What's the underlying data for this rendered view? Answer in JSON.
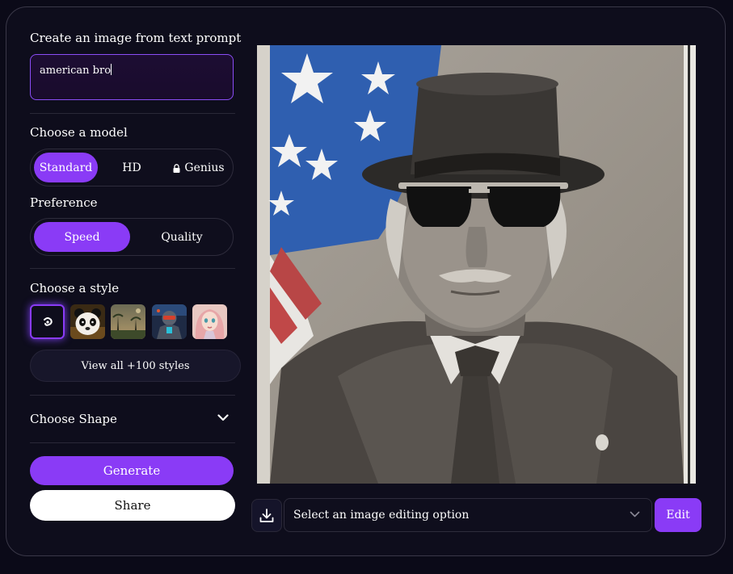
{
  "prompt": {
    "label": "Create an image from text prompt",
    "value": "american bro"
  },
  "model": {
    "label": "Choose a model",
    "options": [
      "Standard",
      "HD",
      "Genius"
    ],
    "selected": "Standard"
  },
  "preference": {
    "label": "Preference",
    "options": [
      "Speed",
      "Quality"
    ],
    "selected": "Speed"
  },
  "style": {
    "label": "Choose a style",
    "view_all_label": "View all +100 styles",
    "thumb_icons": [
      "swirl-icon",
      "panda-thumbnail",
      "landscape-thumbnail",
      "robot-thumbnail",
      "portrait-thumbnail"
    ]
  },
  "shape": {
    "label": "Choose Shape"
  },
  "actions": {
    "generate_label": "Generate",
    "share_label": "Share"
  },
  "editor": {
    "select_placeholder": "Select an image editing option",
    "edit_label": "Edit"
  },
  "colors": {
    "accent": "#8a3bf6",
    "background": "#0e0d1c",
    "border": "#2e2c3c"
  }
}
